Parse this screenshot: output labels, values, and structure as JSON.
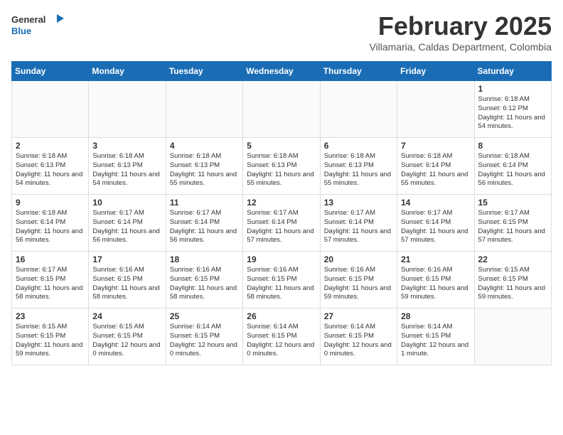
{
  "header": {
    "logo_general": "General",
    "logo_blue": "Blue",
    "month_year": "February 2025",
    "location": "Villamaria, Caldas Department, Colombia"
  },
  "days_of_week": [
    "Sunday",
    "Monday",
    "Tuesday",
    "Wednesday",
    "Thursday",
    "Friday",
    "Saturday"
  ],
  "weeks": [
    [
      {
        "day": "",
        "info": ""
      },
      {
        "day": "",
        "info": ""
      },
      {
        "day": "",
        "info": ""
      },
      {
        "day": "",
        "info": ""
      },
      {
        "day": "",
        "info": ""
      },
      {
        "day": "",
        "info": ""
      },
      {
        "day": "1",
        "info": "Sunrise: 6:18 AM\nSunset: 6:12 PM\nDaylight: 11 hours and 54 minutes."
      }
    ],
    [
      {
        "day": "2",
        "info": "Sunrise: 6:18 AM\nSunset: 6:13 PM\nDaylight: 11 hours and 54 minutes."
      },
      {
        "day": "3",
        "info": "Sunrise: 6:18 AM\nSunset: 6:13 PM\nDaylight: 11 hours and 54 minutes."
      },
      {
        "day": "4",
        "info": "Sunrise: 6:18 AM\nSunset: 6:13 PM\nDaylight: 11 hours and 55 minutes."
      },
      {
        "day": "5",
        "info": "Sunrise: 6:18 AM\nSunset: 6:13 PM\nDaylight: 11 hours and 55 minutes."
      },
      {
        "day": "6",
        "info": "Sunrise: 6:18 AM\nSunset: 6:13 PM\nDaylight: 11 hours and 55 minutes."
      },
      {
        "day": "7",
        "info": "Sunrise: 6:18 AM\nSunset: 6:14 PM\nDaylight: 11 hours and 55 minutes."
      },
      {
        "day": "8",
        "info": "Sunrise: 6:18 AM\nSunset: 6:14 PM\nDaylight: 11 hours and 56 minutes."
      }
    ],
    [
      {
        "day": "9",
        "info": "Sunrise: 6:18 AM\nSunset: 6:14 PM\nDaylight: 11 hours and 56 minutes."
      },
      {
        "day": "10",
        "info": "Sunrise: 6:17 AM\nSunset: 6:14 PM\nDaylight: 11 hours and 56 minutes."
      },
      {
        "day": "11",
        "info": "Sunrise: 6:17 AM\nSunset: 6:14 PM\nDaylight: 11 hours and 56 minutes."
      },
      {
        "day": "12",
        "info": "Sunrise: 6:17 AM\nSunset: 6:14 PM\nDaylight: 11 hours and 57 minutes."
      },
      {
        "day": "13",
        "info": "Sunrise: 6:17 AM\nSunset: 6:14 PM\nDaylight: 11 hours and 57 minutes."
      },
      {
        "day": "14",
        "info": "Sunrise: 6:17 AM\nSunset: 6:14 PM\nDaylight: 11 hours and 57 minutes."
      },
      {
        "day": "15",
        "info": "Sunrise: 6:17 AM\nSunset: 6:15 PM\nDaylight: 11 hours and 57 minutes."
      }
    ],
    [
      {
        "day": "16",
        "info": "Sunrise: 6:17 AM\nSunset: 6:15 PM\nDaylight: 11 hours and 58 minutes."
      },
      {
        "day": "17",
        "info": "Sunrise: 6:16 AM\nSunset: 6:15 PM\nDaylight: 11 hours and 58 minutes."
      },
      {
        "day": "18",
        "info": "Sunrise: 6:16 AM\nSunset: 6:15 PM\nDaylight: 11 hours and 58 minutes."
      },
      {
        "day": "19",
        "info": "Sunrise: 6:16 AM\nSunset: 6:15 PM\nDaylight: 11 hours and 58 minutes."
      },
      {
        "day": "20",
        "info": "Sunrise: 6:16 AM\nSunset: 6:15 PM\nDaylight: 11 hours and 59 minutes."
      },
      {
        "day": "21",
        "info": "Sunrise: 6:16 AM\nSunset: 6:15 PM\nDaylight: 11 hours and 59 minutes."
      },
      {
        "day": "22",
        "info": "Sunrise: 6:15 AM\nSunset: 6:15 PM\nDaylight: 11 hours and 59 minutes."
      }
    ],
    [
      {
        "day": "23",
        "info": "Sunrise: 6:15 AM\nSunset: 6:15 PM\nDaylight: 11 hours and 59 minutes."
      },
      {
        "day": "24",
        "info": "Sunrise: 6:15 AM\nSunset: 6:15 PM\nDaylight: 12 hours and 0 minutes."
      },
      {
        "day": "25",
        "info": "Sunrise: 6:14 AM\nSunset: 6:15 PM\nDaylight: 12 hours and 0 minutes."
      },
      {
        "day": "26",
        "info": "Sunrise: 6:14 AM\nSunset: 6:15 PM\nDaylight: 12 hours and 0 minutes."
      },
      {
        "day": "27",
        "info": "Sunrise: 6:14 AM\nSunset: 6:15 PM\nDaylight: 12 hours and 0 minutes."
      },
      {
        "day": "28",
        "info": "Sunrise: 6:14 AM\nSunset: 6:15 PM\nDaylight: 12 hours and 1 minute."
      },
      {
        "day": "",
        "info": ""
      }
    ]
  ]
}
